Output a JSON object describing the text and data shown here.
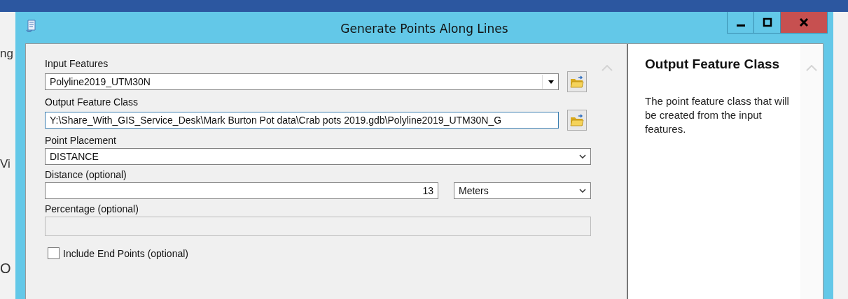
{
  "background_app": {
    "fragments": [
      "ng",
      "Vi",
      "O"
    ]
  },
  "window": {
    "title": "Generate Points Along Lines"
  },
  "form": {
    "input_features": {
      "label": "Input Features",
      "value": "Polyline2019_UTM30N"
    },
    "output_feature_class": {
      "label": "Output Feature Class",
      "value": "Y:\\Share_With_GIS_Service_Desk\\Mark Burton Pot data\\Crab pots 2019.gdb\\Polyline2019_UTM30N_G",
      "focused": true
    },
    "point_placement": {
      "label": "Point Placement",
      "value": "DISTANCE"
    },
    "distance": {
      "label": "Distance (optional)",
      "value": "13",
      "unit": "Meters"
    },
    "percentage": {
      "label": "Percentage (optional)",
      "disabled": true
    },
    "include_end_points": {
      "label": "Include End Points (optional)",
      "checked": false
    }
  },
  "help": {
    "title": "Output Feature Class",
    "text": "The point feature class that will be created from the input features."
  }
}
